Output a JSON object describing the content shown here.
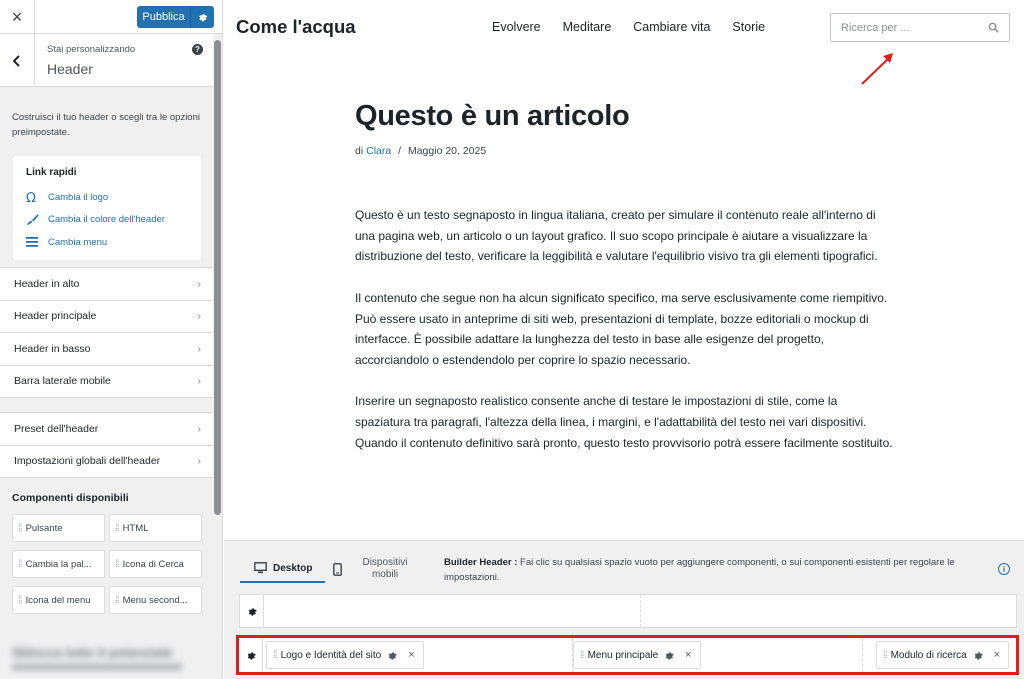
{
  "sidebar": {
    "close_label": "×",
    "publish_label": "Pubblica",
    "customizing_label": "Stai personalizzando",
    "section_title": "Header",
    "help_label": "?",
    "description": "Costruisci il tuo header o scegli tra le opzioni preimpostate.",
    "quick_links": {
      "title": "Link rapidi",
      "items": [
        {
          "label": "Cambia il logo",
          "icon": "omega-icon"
        },
        {
          "label": "Cambia il colore dell'header",
          "icon": "brush-icon"
        },
        {
          "label": "Cambia menu",
          "icon": "menu-icon"
        }
      ]
    },
    "sections": [
      "Header in alto",
      "Header principale",
      "Header in basso",
      "Barra laterale mobile"
    ],
    "settings": [
      "Preset dell'header",
      "Impostazioni globali dell'header"
    ],
    "components_title": "Componenti disponibili",
    "components": [
      "Pulsante",
      "HTML",
      "Cambia la pal...",
      "Icona di Cerca",
      "Icona del menu",
      "Menu second..."
    ],
    "pro_blurred": "Sblocca tutto il potenziale"
  },
  "preview": {
    "site_title": "Come l'acqua",
    "nav": [
      "Evolvere",
      "Meditare",
      "Cambiare vita",
      "Storie"
    ],
    "search_placeholder": "Ricerca per ...",
    "post": {
      "title": "Questo è un articolo",
      "meta_prefix": "di",
      "author": "Clara",
      "separator": "/",
      "date": "Maggio 20, 2025",
      "paragraphs": [
        "Questo è un testo segnaposto in lingua italiana, creato per simulare il contenuto reale all'interno di una pagina web, un articolo o un layout grafico. Il suo scopo principale è aiutare a visualizzare la distribuzione del testo, verificare la leggibilità e valutare l'equilibrio visivo tra gli elementi tipografici.",
        "Il contenuto che segue non ha alcun significato specifico, ma serve esclusivamente come riempitivo. Può essere usato in anteprime di siti web, presentazioni di template, bozze editoriali o mockup di interfacce. È possibile adattare la lunghezza del testo in base alle esigenze del progetto, accorciandolo o estendendolo per coprire lo spazio necessario.",
        "Inserire un segnaposto realistico consente anche di testare le impostazioni di stile, come la spaziatura tra paragrafi, l'altezza della linea, i margini, e l'adattabilità del testo nei vari dispositivi. Quando il contenuto definitivo sarà pronto, questo testo provvisorio potrà essere facilmente sostituito."
      ]
    }
  },
  "builder": {
    "tab_desktop": "Desktop",
    "tab_mobile": "Dispositivi mobili",
    "info_title": "Builder Header :",
    "info_text": " Fai clic su qualsiasi spazio vuoto per aggiungere componenti, o sui componenti esistenti per regolare le impostazioni.",
    "main_row_items": [
      "Logo e Identità del sito",
      "Menu principale",
      "Modulo di ricerca"
    ],
    "remove_label": "×"
  },
  "colors": {
    "accent": "#2271b1",
    "highlight_red": "#e11d1d"
  }
}
